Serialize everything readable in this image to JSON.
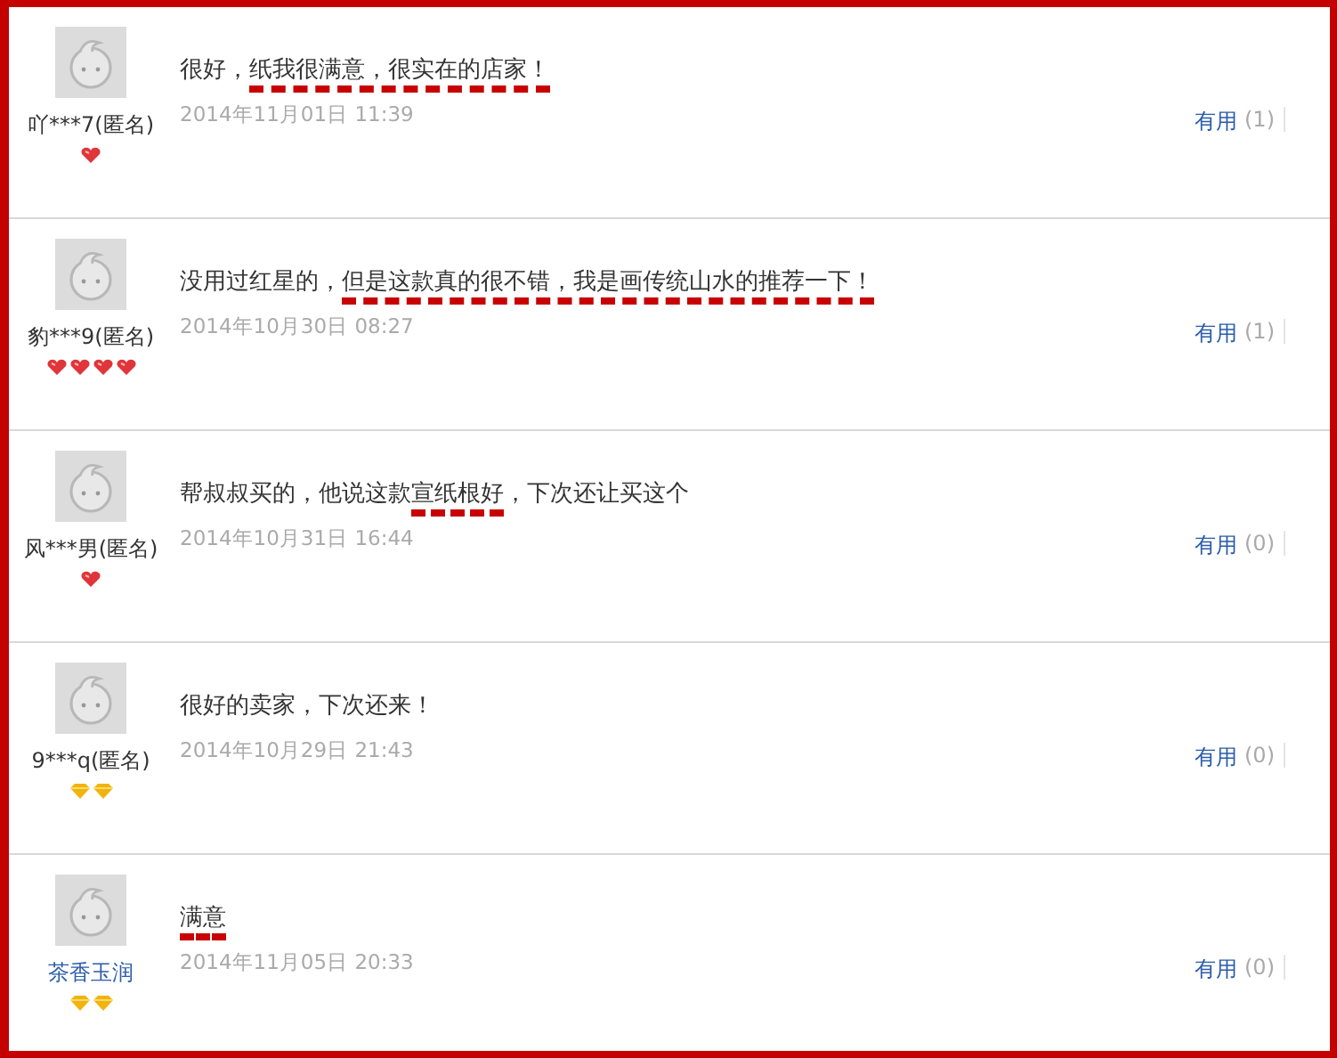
{
  "reviews": [
    {
      "user": "吖***7(匿名)",
      "anonymous": true,
      "badges": [
        {
          "kind": "heart"
        }
      ],
      "comment": [
        {
          "text": "很好，",
          "marked": false
        },
        {
          "text": "纸我很满意，很实在的店家！",
          "marked": true
        }
      ],
      "date": "2014年11月01日 11:39",
      "useful_label": "有用",
      "useful_count": "(1)"
    },
    {
      "user": "豹***9(匿名)",
      "anonymous": true,
      "badges": [
        {
          "kind": "heart"
        },
        {
          "kind": "heart"
        },
        {
          "kind": "heart"
        },
        {
          "kind": "heart"
        }
      ],
      "comment": [
        {
          "text": "没用过红星的，",
          "marked": false
        },
        {
          "text": "但是这款真的很不错，我是画传统山水的推荐一下！",
          "marked": true
        }
      ],
      "date": "2014年10月30日 08:27",
      "useful_label": "有用",
      "useful_count": "(1)"
    },
    {
      "user": "风***男(匿名)",
      "anonymous": true,
      "badges": [
        {
          "kind": "heart"
        }
      ],
      "comment": [
        {
          "text": "帮叔叔买的，他说这款",
          "marked": false
        },
        {
          "text": "宣纸根好",
          "marked": true
        },
        {
          "text": "，下次还让买这个",
          "marked": false
        }
      ],
      "date": "2014年10月31日 16:44",
      "useful_label": "有用",
      "useful_count": "(0)"
    },
    {
      "user": "9***q(匿名)",
      "anonymous": true,
      "badges": [
        {
          "kind": "diamond"
        },
        {
          "kind": "diamond"
        }
      ],
      "comment": [
        {
          "text": "很好的卖家，下次还来！",
          "marked": false
        }
      ],
      "date": "2014年10月29日 21:43",
      "useful_label": "有用",
      "useful_count": "(0)"
    },
    {
      "user": "茶香玉润",
      "anonymous": false,
      "badges": [
        {
          "kind": "diamond"
        },
        {
          "kind": "diamond"
        }
      ],
      "comment": [
        {
          "text": "满意",
          "marked": true
        }
      ],
      "date": "2014年11月05日 20:33",
      "useful_label": "有用",
      "useful_count": "(0)"
    }
  ]
}
